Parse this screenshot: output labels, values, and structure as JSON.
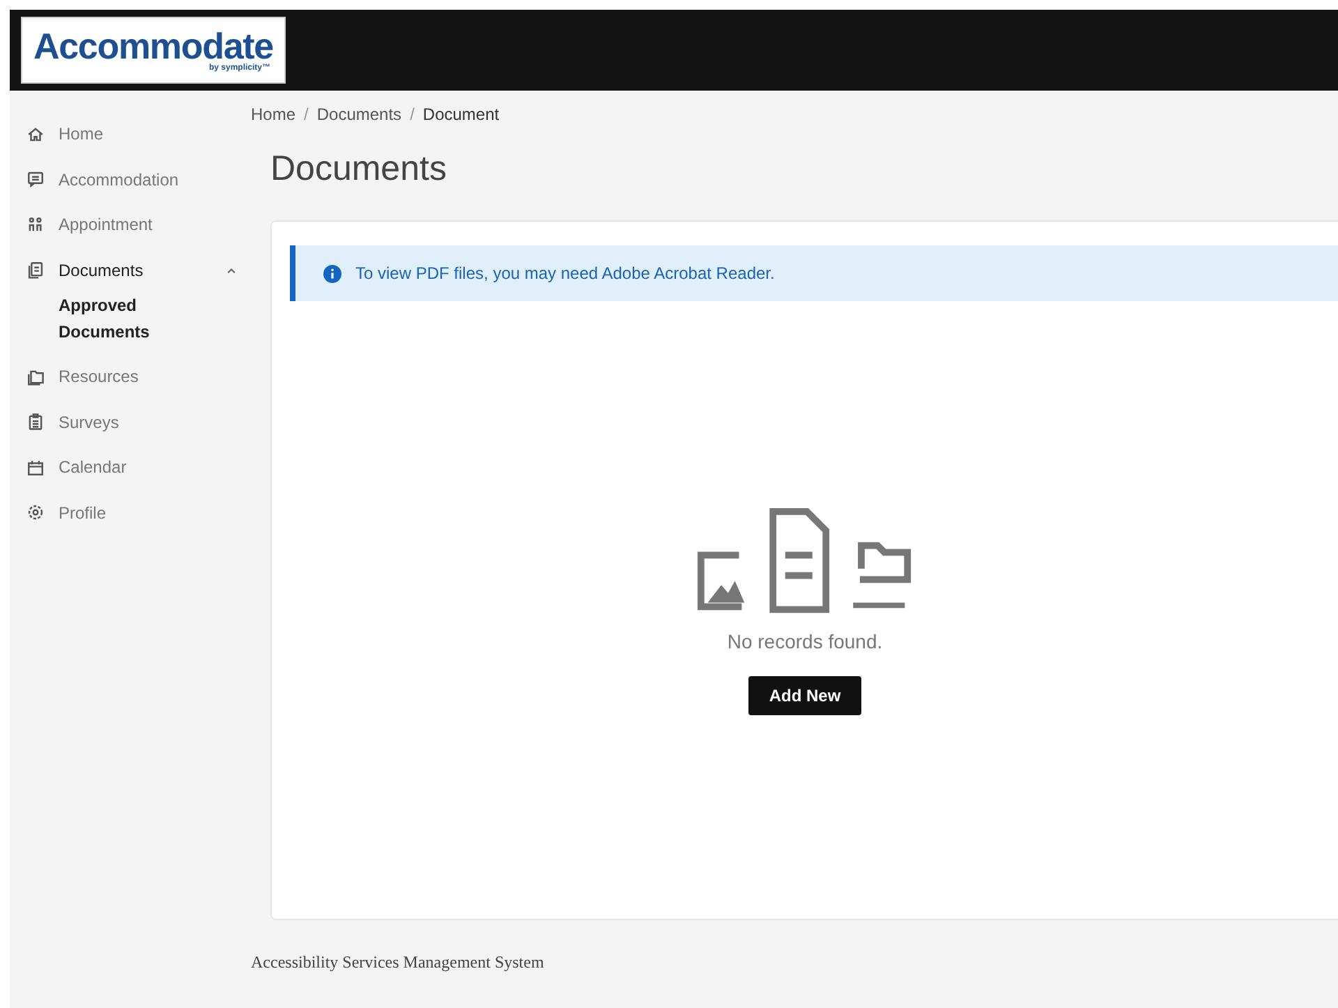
{
  "logo": {
    "name": "Accommodate",
    "byline": "by symplicity™"
  },
  "sidebar": {
    "items": [
      {
        "label": "Home",
        "selected": false
      },
      {
        "label": "Accommodation",
        "selected": false
      },
      {
        "label": "Appointment",
        "selected": false
      },
      {
        "label": "Documents",
        "selected": true,
        "expanded": true,
        "children": [
          {
            "label": "Approved Documents",
            "selected": true
          }
        ]
      },
      {
        "label": "Resources",
        "selected": false
      },
      {
        "label": "Surveys",
        "selected": false
      },
      {
        "label": "Calendar",
        "selected": false
      },
      {
        "label": "Profile",
        "selected": false
      }
    ]
  },
  "breadcrumb": {
    "items": [
      "Home",
      "Documents",
      "Document"
    ],
    "separator": "/"
  },
  "page_title": "Documents",
  "alert": {
    "text": "To view PDF files, you may need Adobe Acrobat Reader."
  },
  "empty_state": {
    "message": "No records found.",
    "button": "Add New"
  },
  "footer": "Accessibility Services Management System"
}
